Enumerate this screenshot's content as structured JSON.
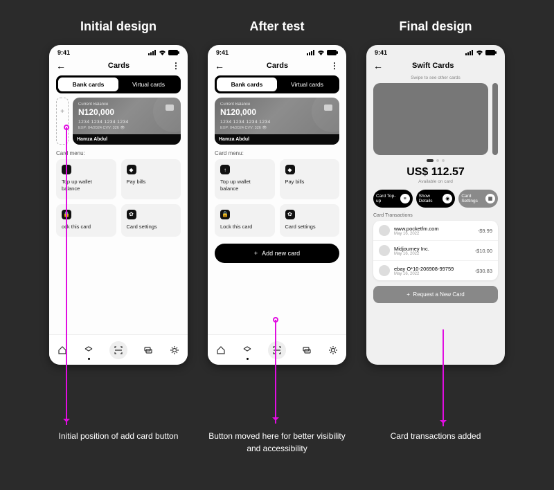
{
  "columns": {
    "initial": {
      "title": "Initial design",
      "caption": "Initial position of add card button"
    },
    "after": {
      "title": "After test",
      "caption": "Button moved here for better visibility and  accessibility"
    },
    "final": {
      "title": "Final design",
      "caption": "Card transactions added"
    }
  },
  "statusbar": {
    "time": "9:41"
  },
  "header": {
    "cards_title": "Cards",
    "swift_title": "Swift Cards"
  },
  "tabs": {
    "bank": "Bank cards",
    "virtual": "Virtual cards"
  },
  "credit_card": {
    "balance_label": "Current Balance",
    "balance": "N120,000",
    "digits": "1234  1234  1234  1234",
    "meta": "EXP: 04/2024   CVV: 326 👁",
    "holder": "Hamza Abdul"
  },
  "card_menu_label": "Card menu:",
  "tiles": {
    "topup": "Top up wallet balance",
    "paybills": "Pay bills",
    "lock_initial": "ock this card",
    "lock": "Lock this card",
    "settings": "Card settings"
  },
  "add_new_card": "Add new card",
  "final": {
    "swipe_hint": "Swipe to see other cards",
    "amount": "US$ 112.57",
    "available": "Available on card",
    "actions": {
      "topup": "Card Top-up",
      "details": "Show Details",
      "settings": "Card Settings"
    },
    "section": "Card Transactions",
    "transactions": [
      {
        "merchant": "www.pocketfm.com",
        "date": "May 16, 2022",
        "amount": "-$9.99"
      },
      {
        "merchant": "Midjourney Inc.",
        "date": "May 16, 2022",
        "amount": "-$10.00"
      },
      {
        "merchant": "ebay O*10-206908-99759",
        "date": "May 16, 2022",
        "amount": "-$30.83"
      }
    ],
    "request": "Request a New Card"
  }
}
